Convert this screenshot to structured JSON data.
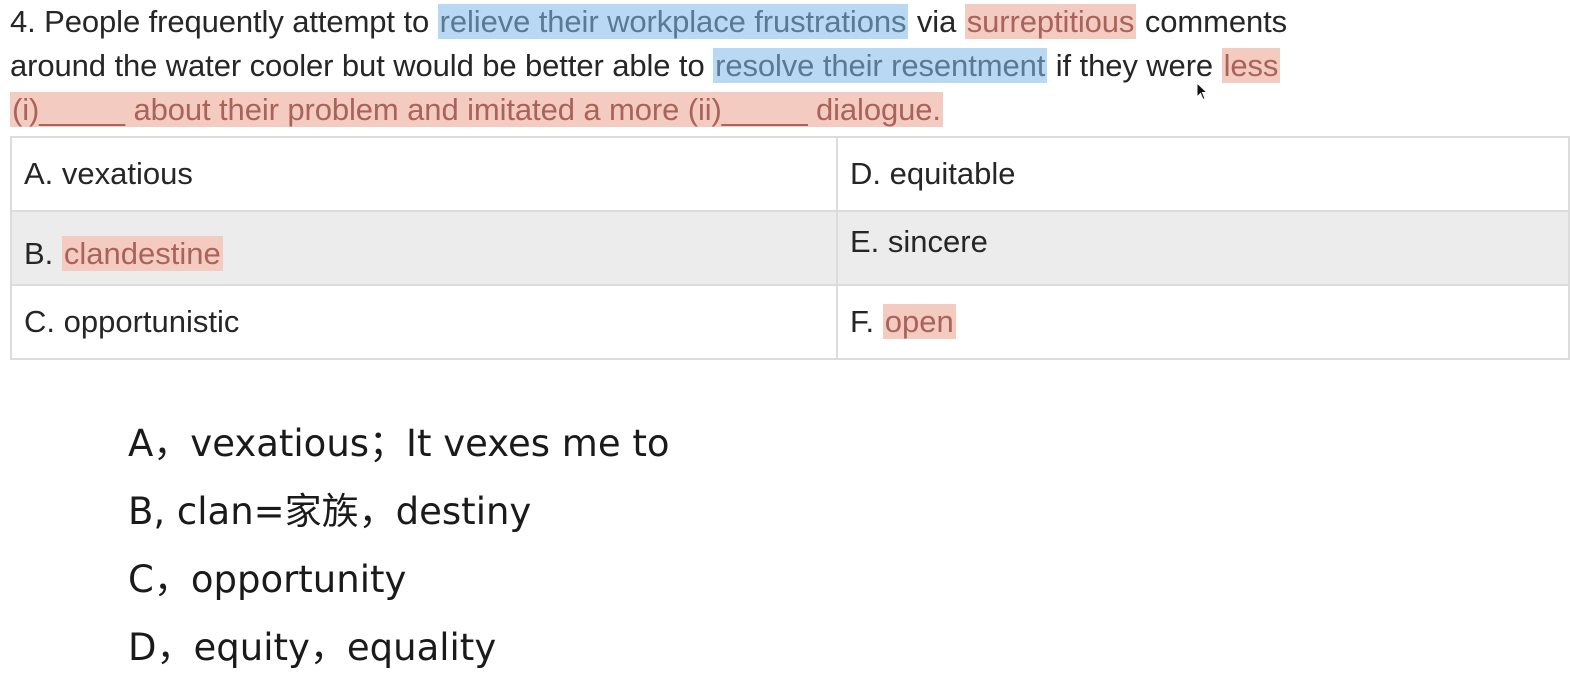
{
  "question": {
    "line1": {
      "prefix": "4. People frequently attempt to ",
      "hl_blue_1": "relieve their workplace frustrations",
      "mid": " via ",
      "hl_red_1": "surreptitious",
      "suffix": " comments"
    },
    "line2": {
      "prefix": "around the water cooler but would be better able to ",
      "hl_blue_2": "resolve their resentment",
      "mid": " if they were ",
      "hl_red_2": "less"
    },
    "line3": {
      "hl_red_3": "(i)_____ about their problem and imitated a more (ii)_____ dialogue."
    }
  },
  "choices": {
    "a": "A. vexatious",
    "b_prefix": "B. ",
    "b_word": "clandestine",
    "c": "C. opportunistic",
    "d": "D. equitable",
    "e": "E. sincere",
    "f_prefix": "F. ",
    "f_word": "open"
  },
  "notes": [
    "A，vexatious；It vexes me to",
    "B, clan=家族，destiny",
    "C，opportunity",
    "D，equity，equality"
  ],
  "colors": {
    "highlight_blue": "#b9d8f3",
    "highlight_red": "#f4cbc1",
    "row_shade": "#ececec"
  }
}
